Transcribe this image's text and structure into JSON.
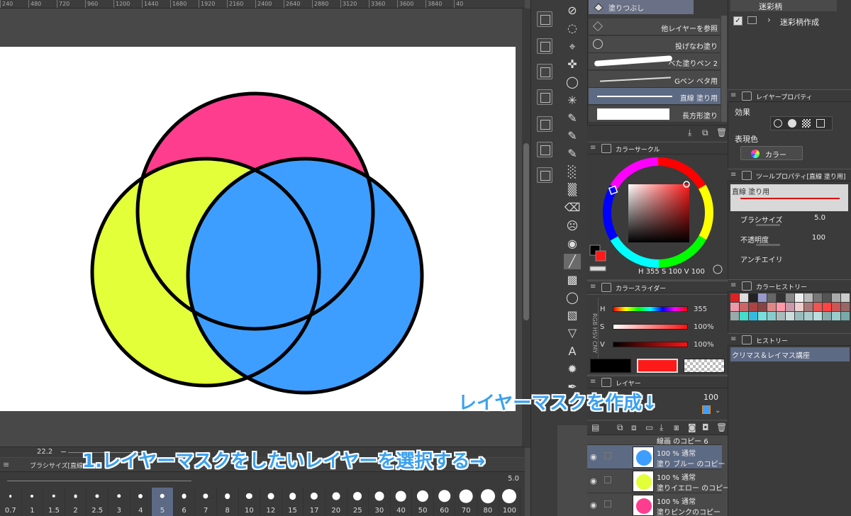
{
  "ruler": {
    "ticks": [
      "240",
      "480",
      "720",
      "960",
      "1200",
      "1440",
      "1680",
      "1920",
      "2160",
      "2400",
      "2640",
      "2880",
      "3120",
      "3360",
      "3600",
      "3840",
      "40"
    ]
  },
  "canvas": {
    "circles": [
      {
        "name": "pink",
        "color": "#ff3d8f"
      },
      {
        "name": "yellow",
        "color": "#e2ff3a"
      },
      {
        "name": "blue",
        "color": "#3d9eff"
      }
    ]
  },
  "zoom": {
    "value": "22.2",
    "minus": "−"
  },
  "brush_panel": {
    "menu": "≡",
    "title": "ブラシサイズ[直線",
    "value": "5.0"
  },
  "brush_sizes": [
    "0.7",
    "1",
    "1.5",
    "2",
    "2.5",
    "3",
    "4",
    "5",
    "6",
    "7",
    "8",
    "10",
    "12",
    "15",
    "17",
    "20",
    "25",
    "30",
    "40",
    "50",
    "60",
    "70",
    "80",
    "100"
  ],
  "brush_active": "5",
  "tools": [
    "⊘",
    "◌",
    "⌖",
    "✜",
    "◯",
    "✳",
    "✎",
    "✎",
    "✎",
    "░",
    "▒",
    "⌫",
    "☹",
    "◉",
    "╱",
    "▩",
    "◯",
    "▧",
    "▽",
    "A",
    "✹",
    "✒"
  ],
  "subtool": {
    "tab": "塗りつぶし",
    "items": [
      {
        "label": "他レイヤーを参照"
      },
      {
        "label": "投げなわ塗り"
      },
      {
        "label": "べた塗りペン 2"
      },
      {
        "label": "Gペン ベタ用"
      },
      {
        "label": "直線 塗り用"
      },
      {
        "label": "長方形塗り"
      }
    ]
  },
  "color_circle": {
    "title": "カラーサークル",
    "readout": "H 355 S 100 V 100",
    "fg": "#000000",
    "bg": "#ff1a1a"
  },
  "color_slider": {
    "title": "カラースライダー",
    "tabs": "RGB HSV CMY",
    "rows": [
      {
        "key": "H",
        "value": "355"
      },
      {
        "key": "S",
        "value": "100%"
      },
      {
        "key": "V",
        "value": "100%"
      }
    ]
  },
  "layer_panel": {
    "title": "レイヤー",
    "opacity": "100",
    "layers": [
      {
        "mode": "",
        "name": "線画 のコピー 6"
      },
      {
        "mode": "100 % 通常",
        "name": "塗り ブルー のコピー",
        "color": "#3d9eff"
      },
      {
        "mode": "100 % 通常",
        "name": "塗りイエロー のコピー",
        "color": "#e2ff3a"
      },
      {
        "mode": "100 % 通常",
        "name": "塗りピンクのコピー",
        "color": "#ff3d8f"
      }
    ]
  },
  "right": {
    "pattern_hdr": "迷彩柄",
    "pattern_item": "迷彩柄作成",
    "layer_prop_title": "レイヤープロパティ",
    "effect_label": "効果",
    "express_label": "表現色",
    "express_value": "カラー",
    "tool_prop_title": "ツールプロパティ[直線 塗り用]",
    "tool_prop_name": "直線 塗り用",
    "brush_size_label": "ブラシサイズ",
    "brush_size_value": "5.0",
    "opacity_label": "不透明度",
    "opacity_value": "100",
    "antialias_label": "アンチエイリ",
    "color_history_title": "カラーヒストリー",
    "history_title": "ヒストリー",
    "history_item": "クリマス＆レイマス講座"
  },
  "color_history": [
    "#d22",
    "#ddd",
    "#222",
    "#99c",
    "#666",
    "#333",
    "#888",
    "#eee",
    "#bbb",
    "#777",
    "#555",
    "#aaa",
    "#ccc",
    "#e9a",
    "#c66",
    "#a44",
    "#844",
    "#d88",
    "#f9a",
    "#c9a",
    "#ecc",
    "#a77",
    "#e55",
    "#f44",
    "#c55",
    "#966",
    "#9aa",
    "#4dc",
    "#3bd",
    "#7dd",
    "#8cc",
    "#abb",
    "#cdd",
    "#9bb",
    "#acc",
    "#bdd",
    "#8aa",
    "#9cc",
    "#7aa"
  ],
  "annotations": {
    "mask": "レイヤーマスクを作成↓",
    "select": "1.レイヤーマスクをしたいレイヤーを選択する→"
  }
}
